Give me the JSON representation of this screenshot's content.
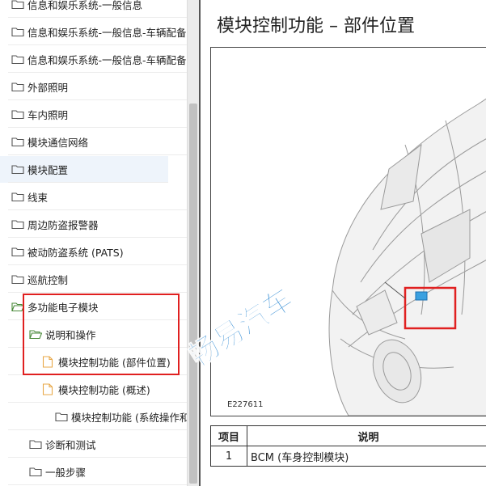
{
  "sidebar": {
    "items": [
      {
        "label": "信息和娱乐系统-一般信息",
        "type": "folder",
        "level": 0
      },
      {
        "label": "信息和娱乐系统-一般信息-车辆配备",
        "type": "folder",
        "level": 0
      },
      {
        "label": "信息和娱乐系统-一般信息-车辆配备",
        "type": "folder",
        "level": 0
      },
      {
        "label": "外部照明",
        "type": "folder",
        "level": 0
      },
      {
        "label": "车内照明",
        "type": "folder",
        "level": 0
      },
      {
        "label": "模块通信网络",
        "type": "folder",
        "level": 0
      },
      {
        "label": "模块配置",
        "type": "folder",
        "level": 0
      },
      {
        "label": "线束",
        "type": "folder",
        "level": 0
      },
      {
        "label": "周边防盗报警器",
        "type": "folder",
        "level": 0
      },
      {
        "label": "被动防盗系统 (PATS)",
        "type": "folder",
        "level": 0
      },
      {
        "label": "巡航控制",
        "type": "folder",
        "level": 0
      },
      {
        "label": "多功能电子模块",
        "type": "folder-open",
        "level": 0
      },
      {
        "label": "说明和操作",
        "type": "folder-open",
        "level": 1
      },
      {
        "label": "模块控制功能 (部件位置)",
        "type": "document",
        "level": 2
      },
      {
        "label": "模块控制功能 (概述)",
        "type": "document",
        "level": 2
      },
      {
        "label": "模块控制功能 (系统操作和",
        "type": "folder",
        "level": 3
      },
      {
        "label": "诊断和测试",
        "type": "folder",
        "level": 1
      },
      {
        "label": "一般步骤",
        "type": "folder",
        "level": 1
      }
    ]
  },
  "content": {
    "title": "模块控制功能 – 部件位置",
    "figure_code": "E227611",
    "table": {
      "headers": [
        "项目",
        "说明"
      ],
      "rows": [
        [
          "1",
          "BCM (车身控制模块)"
        ]
      ]
    }
  },
  "watermark": "畅易汽车",
  "colors": {
    "folder": "#4a8a3a",
    "document": "#e8a94a",
    "highlight": "#e02020",
    "watermark": "#1a7fd0",
    "selected": "#eef4fb"
  }
}
